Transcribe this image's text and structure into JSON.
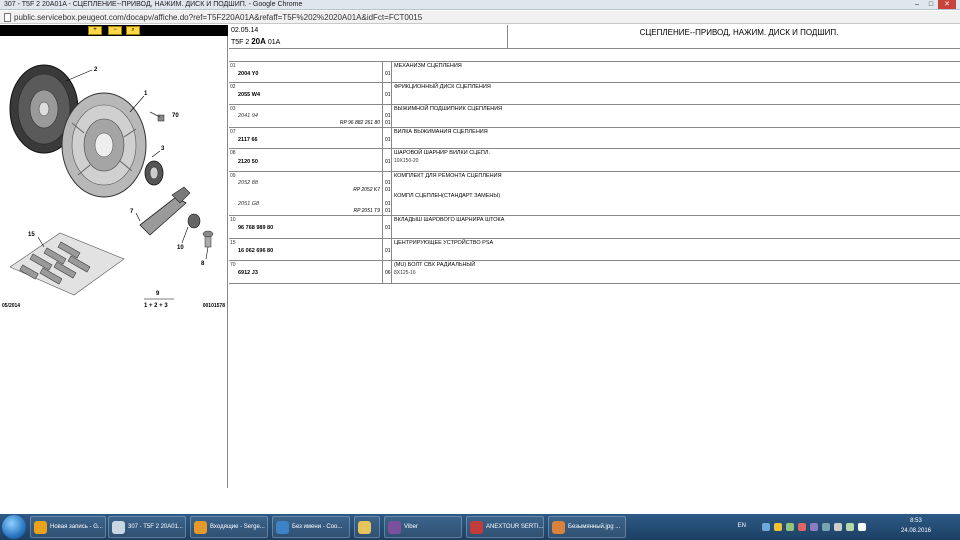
{
  "window": {
    "title": "307 - T5F 2 20A01A - СЦЕПЛЕНИЕ--ПРИВОД, НАЖИМ. ДИСК И ПОДШИП. - Google Chrome",
    "minimize": "–",
    "maximize": "□",
    "close": "✕"
  },
  "address": {
    "url": "public.servicebox.peugeot.com/docapv/affiche.do?ref=T5F220A01A&refaff=T5F%202%2020A01A&idFct=FCT0015"
  },
  "left": {
    "toolbar": [
      "+",
      "−",
      "⌕"
    ],
    "callouts": [
      "2",
      "1",
      "70",
      "3",
      "7",
      "10",
      "8",
      "15",
      "9",
      "1 + 2 + 3"
    ],
    "footer_date": "05/2014",
    "footer_code": "00101578"
  },
  "header": {
    "date": "02.05.14",
    "model_pre": "T5F 2 ",
    "model_bold": "20A",
    "model_post": " 01A",
    "title": "СЦЕПЛЕНИЕ--ПРИВОД, НАЖИМ. ДИСК И ПОДШИП."
  },
  "rows": [
    {
      "pos": "01",
      "ref": "2004 Y0",
      "qty": "01",
      "desc": "МЕХАНИЗМ СЦЕПЛЕНИЯ",
      "sub": ""
    },
    {
      "pos": "02",
      "ref": "2055 W4",
      "qty": "01",
      "desc": "ФРИКЦИОННЫЙ ДИСК СЦЕПЛЕНИЯ",
      "sub": ""
    },
    {
      "pos": "03",
      "ref": "2041 94",
      "ref_italic": true,
      "rp": "RP 96 882 261 80",
      "qty": "01",
      "qty2": "01",
      "desc": "ВЫЖИМНОЙ ПОДШИПНИК СЦЕПЛЕНИЯ",
      "sub": ""
    },
    {
      "pos": "07",
      "ref": "2117 66",
      "qty": "01",
      "desc": "ВИЛКА ВЫЖИМАНИЯ СЦЕПЛЕНИЯ",
      "sub": ""
    },
    {
      "pos": "08",
      "ref": "2120 50",
      "qty": "01",
      "desc": "ШАРОВОЙ ШАРНИР ВИЛКИ СЦЕПЛ.",
      "sub": "10X150-20"
    },
    {
      "pos": "09",
      "ref": "2052 88",
      "ref_italic": true,
      "rp": "RP 2052 K7",
      "qty": "01",
      "desc": "КОМПЛЕКТ ДЛЯ РЕМОНТА СЦЕПЛЕНИЯ",
      "ref2": "2051 G8",
      "rp2": "RP 2051 T9",
      "desc2": "КОМПЛ СЦЕПЛЕН(СТАНДАРТ ЗАМЕНЫ)",
      "qty3": "01",
      "qty4": "01",
      "qty5": "01"
    },
    {
      "pos": "10",
      "ref": "96 768 989 80",
      "qty": "01",
      "desc": "ВКЛАДЫШ ШАРОВОГО ШАРНИРА ШТОКА",
      "sub": ""
    },
    {
      "pos": "15",
      "ref": "16 062 696 80",
      "qty": "01",
      "desc": "ЦЕНТРИРУЮЩЕЕ УСТРОЙСТВО PSA",
      "sub": ""
    },
    {
      "pos": "70",
      "ref": "6912 J3",
      "qty": "06",
      "desc": "(MU) БОЛТ СВХ РАДИАЛЬНЫЙ",
      "sub": "8X125-16"
    }
  ],
  "taskbar": {
    "items": [
      {
        "label": "Новая запись - G...",
        "color": "#e8a21b"
      },
      {
        "label": "307 - T5F 2 20A01...",
        "color": "#c9d6e4"
      },
      {
        "label": "Входящие - Serge...",
        "color": "#e39a2a"
      },
      {
        "label": "Без имени - Coo...",
        "color": "#3d83c8"
      },
      {
        "label": "",
        "color": "#e5c45a"
      },
      {
        "label": "Viber",
        "color": "#7b519d"
      },
      {
        "label": "ANEXTOUR SERTI...",
        "color": "#c23c3c"
      },
      {
        "label": "Безымянный.jpg ...",
        "color": "#d9823b"
      }
    ],
    "lang": "EN",
    "time": "8:53",
    "date": "24.08.2016"
  }
}
